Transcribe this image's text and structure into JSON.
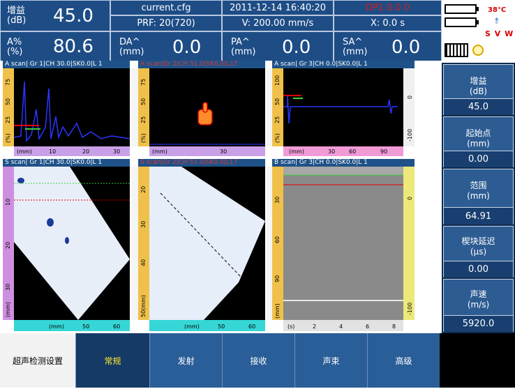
{
  "header": {
    "gain_label": "增益",
    "gain_unit": "(dB)",
    "gain_value": "45.0",
    "pct_label": "A%",
    "pct_unit": "(%)",
    "pct_value": "80.6",
    "file": "current.cfg",
    "prf": "PRF: 20(720)",
    "datetime": "2011-12-14 16:40:20",
    "velocity": "V: 200.00 mm/s",
    "dp": "DP1 0.0 0",
    "x": "X: 0.0 s",
    "da_label": "DA^",
    "da_unit": "(mm)",
    "da_value": "0.0",
    "pa_label": "PA^",
    "pa_unit": "(mm)",
    "pa_value": "0.0",
    "sa_label": "SA^",
    "sa_unit": "(mm)",
    "sa_value": "0.0"
  },
  "status": {
    "temperature": "38°C",
    "svw": "S V W",
    "battery_icon": "battery-icon",
    "keyboard_icon": "keyboard-icon",
    "clock_icon": "clock-icon",
    "wifi_icon": "signal-icon"
  },
  "panels": {
    "a1_title": "A scan| Gr 1|CH 30.0|SK0.0|L 1",
    "a2_title": "A scan|Gr 2|CH 51.0|SK0.0|L17",
    "a3_title": "A scan| Gr 3|CH 0.0|SK0.0|L 1",
    "s1_title": "S scan| Gr 1|CH 30.0|SK0.0|L 1",
    "s2_title": "S scan|Gr 2|CH 51.0|SK0.0|L17",
    "b3_title": "B scan| Gr 3|CH 0.0|SK0.0|L 1"
  },
  "axes": {
    "a1_y": [
      "75",
      "50",
      "25",
      "(%)"
    ],
    "a1_x": [
      "(mm)",
      "10",
      "20",
      "30"
    ],
    "a2_y": [
      "75",
      "50",
      "25",
      "(%)"
    ],
    "a2_x": [
      "(mm)",
      "30"
    ],
    "a3_y": [
      "100",
      "50",
      "25",
      "(%)"
    ],
    "a3_right": [
      "0",
      "-100"
    ],
    "a3_x": [
      "(mm)",
      "30",
      "60",
      "90"
    ],
    "s1_y": [
      "10",
      "20",
      "30",
      "(mm)"
    ],
    "s1_x": [
      "(mm)",
      "50",
      "60"
    ],
    "s2_y": [
      "20",
      "30",
      "40",
      "50(mm)"
    ],
    "s2_x": [
      "(mm)",
      "50",
      "60"
    ],
    "b3_y": [
      "30",
      "60",
      "90",
      "(mm)"
    ],
    "b3_right": [
      "0",
      "-100"
    ],
    "b3_x": [
      "(s)",
      "2",
      "4",
      "6",
      "8"
    ]
  },
  "sidebar": {
    "items": [
      {
        "label": "增益",
        "unit": "(dB)",
        "value": "45.0"
      },
      {
        "label": "起始点",
        "unit": "(mm)",
        "value": "0.00"
      },
      {
        "label": "范围",
        "unit": "(mm)",
        "value": "64.91"
      },
      {
        "label": "楔块延迟",
        "unit": "(μs)",
        "value": "0.00"
      },
      {
        "label": "声速",
        "unit": "(m/s)",
        "value": "5920.0"
      }
    ]
  },
  "tabs": {
    "menu_label": "超声检测设置",
    "items": [
      "常规",
      "发射",
      "接收",
      "声束",
      "高级"
    ]
  },
  "colors": {
    "header_bg": "#1e4d86",
    "panel_title_bg": "#1f5288",
    "tab_active_text": "#ffea2a",
    "alarm_red": "#e00000"
  }
}
